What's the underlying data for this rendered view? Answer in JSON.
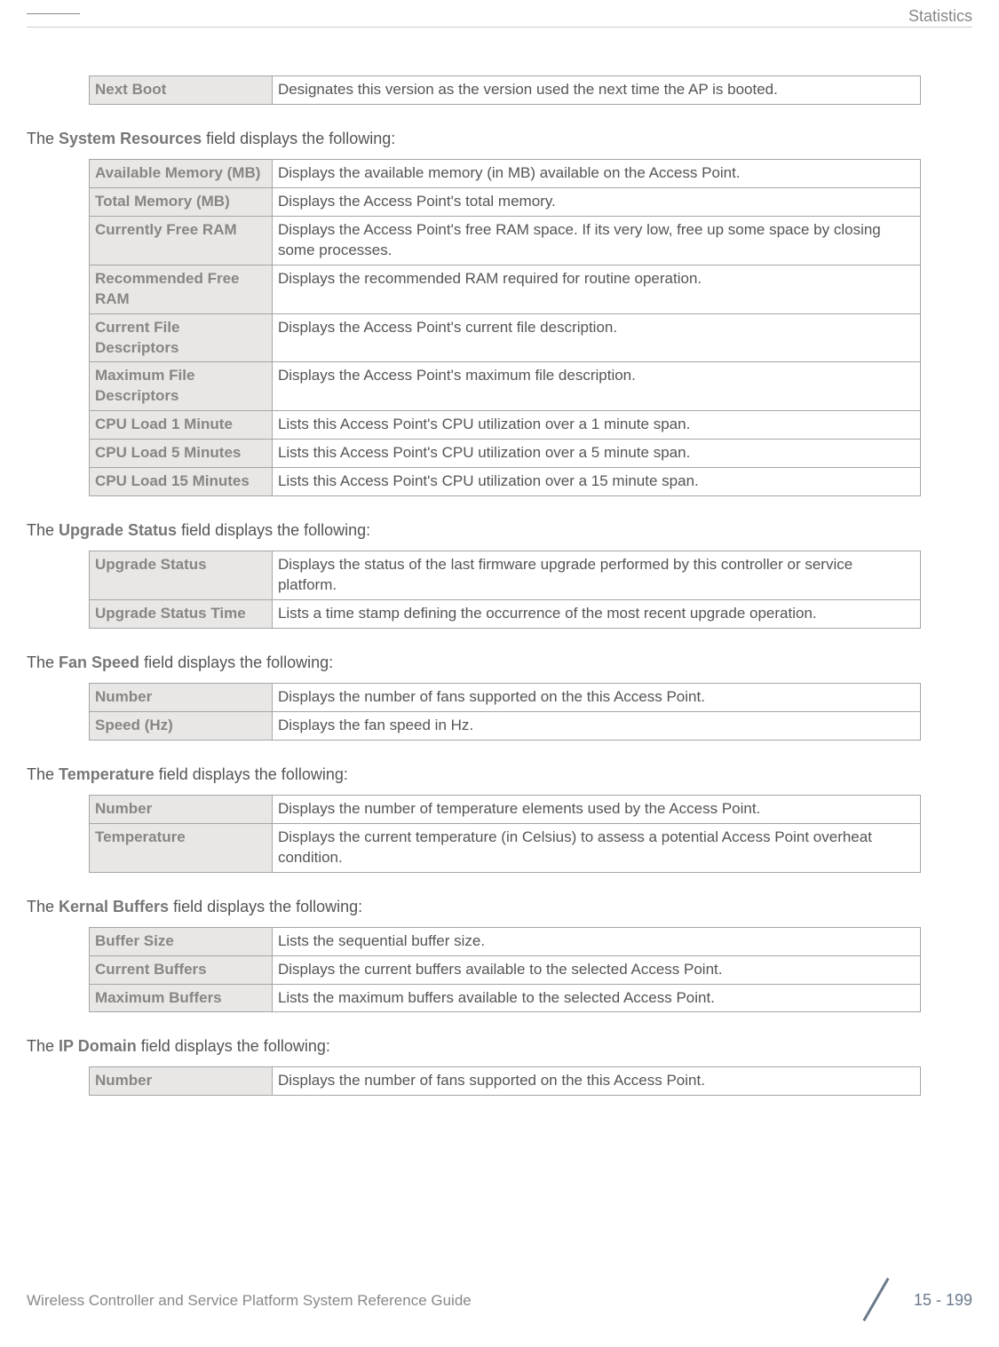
{
  "header": {
    "section_title": "Statistics"
  },
  "tables": {
    "next_boot": {
      "rows": [
        {
          "label": "Next Boot",
          "desc": "Designates this version as the version used the next time the AP is booted."
        }
      ]
    },
    "system_resources": {
      "intro_prefix": "The ",
      "intro_bold": "System Resources",
      "intro_suffix": " field displays the following:",
      "rows": [
        {
          "label": "Available Memory (MB)",
          "desc": "Displays the available memory (in MB) available on the Access Point."
        },
        {
          "label": "Total Memory (MB)",
          "desc": "Displays the Access Point's total memory."
        },
        {
          "label": "Currently Free RAM",
          "desc": "Displays the Access Point's free RAM space. If its very low, free up some space by closing some processes."
        },
        {
          "label": "Recommended Free RAM",
          "desc": "Displays the recommended RAM required for routine operation."
        },
        {
          "label": "Current File Descriptors",
          "desc": "Displays the Access Point's current file description."
        },
        {
          "label": "Maximum File Descriptors",
          "desc": "Displays the Access Point's maximum file description."
        },
        {
          "label": "CPU Load 1 Minute",
          "desc": "Lists this Access Point's CPU utilization over a 1 minute span."
        },
        {
          "label": "CPU Load 5 Minutes",
          "desc": "Lists this Access Point's CPU utilization over a 5 minute span."
        },
        {
          "label": "CPU Load 15 Minutes",
          "desc": "Lists this Access Point's CPU utilization over a 15 minute span."
        }
      ]
    },
    "upgrade_status": {
      "intro_prefix": "The ",
      "intro_bold": "Upgrade Status",
      "intro_suffix": " field displays the following:",
      "rows": [
        {
          "label": "Upgrade Status",
          "desc": "Displays the status of the last firmware upgrade performed by this controller or service platform."
        },
        {
          "label": "Upgrade Status Time",
          "desc": "Lists a time stamp defining the occurrence of the most recent upgrade operation."
        }
      ]
    },
    "fan_speed": {
      "intro_prefix": "The ",
      "intro_bold": "Fan Speed",
      "intro_suffix": " field displays the following:",
      "rows": [
        {
          "label": "Number",
          "desc": "Displays the number of fans supported on the this Access Point."
        },
        {
          "label": "Speed (Hz)",
          "desc": "Displays the fan speed in Hz."
        }
      ]
    },
    "temperature": {
      "intro_prefix": "The ",
      "intro_bold": "Temperature",
      "intro_suffix": " field displays the following:",
      "rows": [
        {
          "label": "Number",
          "desc": "Displays the number of temperature elements used by the Access Point."
        },
        {
          "label": "Temperature",
          "desc": "Displays the current temperature (in Celsius) to assess a potential Access Point overheat condition."
        }
      ]
    },
    "kernal_buffers": {
      "intro_prefix": "The ",
      "intro_bold": "Kernal Buffers",
      "intro_suffix": " field displays the following:",
      "rows": [
        {
          "label": "Buffer Size",
          "desc": "Lists the sequential buffer size."
        },
        {
          "label": "Current Buffers",
          "desc": "Displays the current buffers available to the selected Access Point."
        },
        {
          "label": "Maximum Buffers",
          "desc": "Lists the maximum buffers available to the selected Access Point."
        }
      ]
    },
    "ip_domain": {
      "intro_prefix": "The ",
      "intro_bold": "IP Domain",
      "intro_suffix": " field displays the following:",
      "rows": [
        {
          "label": "Number",
          "desc": "Displays the number of fans supported on the this Access Point."
        }
      ]
    }
  },
  "footer": {
    "doc_title": "Wireless Controller and Service Platform System Reference Guide",
    "page": "15 - 199"
  }
}
